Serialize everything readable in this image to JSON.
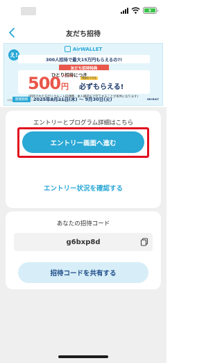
{
  "colors": {
    "accent": "#2aa8d6",
    "highlight": "#e0101e",
    "promo_red": "#e8574a",
    "navy": "#1d3b6b",
    "background_gray": "#efefef"
  },
  "status_bar": {
    "icons": [
      "signal-icon",
      "wifi-icon",
      "battery-icon"
    ]
  },
  "nav": {
    "back_icon": "chevron-left-icon",
    "title": "友だち招待"
  },
  "banner": {
    "brand": "AirWALLET",
    "badge": "え!",
    "headline": "300人招待で最大15万円もらえるの?!",
    "perk_tag": "友だち招待特典",
    "per_invite": "ひとり招待につき",
    "amount": "500",
    "yen": "円",
    "stack_note": "COIN 残高",
    "cash_note": "現金化できる",
    "main_text": "必ずもらえる!",
    "condition": "(招待された方がリクルートID連携、本人確認まで完了することが条件になります)",
    "fine_print": "※現金の受け取りにはCOINアカウントとリクルートID連携・本人確認が必要です",
    "recruit": "RECRUIT",
    "period_label": "開催期間",
    "period": "2025年8月21日(木) ～ 9月30日(火)"
  },
  "entry_card": {
    "title": "エントリーとプログラム詳細はこちら",
    "entry_button": "エントリー画面へ進む",
    "status_link": "エントリー状況を確認する"
  },
  "code_card": {
    "title": "あなたの招待コード",
    "code": "g6bxp8d",
    "copy_icon": "copy-icon",
    "share_button": "招待コードを共有する"
  }
}
